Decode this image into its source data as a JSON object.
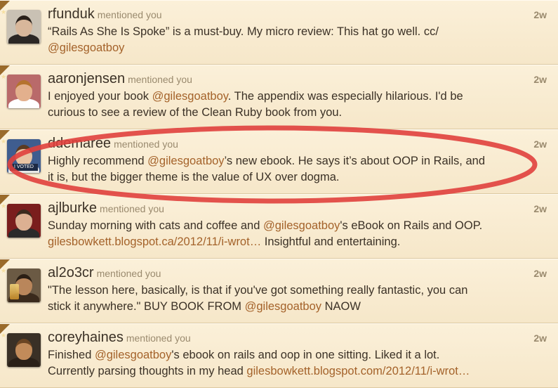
{
  "mention_label": "mentioned you",
  "colors": {
    "link": "#a4622a",
    "highlight_ellipse": "#e0403d",
    "background": "#f5e8cc"
  },
  "tweets": [
    {
      "username": "rfunduk",
      "time": "2w",
      "avatar": "avatar-dark-hair-man",
      "line1": [
        {
          "t": "“Rails As She Is Spoke” is a must-buy. My micro review: This hat go well. cc/",
          "link": false
        }
      ],
      "line2": [
        {
          "t": "@gilesgoatboy",
          "link": true
        }
      ]
    },
    {
      "username": "aaronjensen",
      "time": "2w",
      "avatar": "avatar-flag-man",
      "line1": [
        {
          "t": "I enjoyed your book ",
          "link": false
        },
        {
          "t": "@gilesgoatboy",
          "link": true
        },
        {
          "t": ". The appendix was especially hilarious. I'd be",
          "link": false
        }
      ],
      "line2": [
        {
          "t": "curious to see a review of the Clean Ruby book from you.",
          "link": false
        }
      ]
    },
    {
      "username": "ddemaree",
      "time": "2w",
      "avatar": "avatar-i-voted",
      "avatar_tag": "I VOTED",
      "line1": [
        {
          "t": "Highly recommend ",
          "link": false
        },
        {
          "t": "@gilesgoatboy",
          "link": true
        },
        {
          "t": "’s new ebook. He says it’s about OOP in Rails, and",
          "link": false
        }
      ],
      "line2": [
        {
          "t": "it is, but the bigger theme is the value of UX over dogma.",
          "link": false
        }
      ]
    },
    {
      "username": "ajlburke",
      "time": "2w",
      "avatar": "avatar-young-man",
      "line1": [
        {
          "t": "Sunday morning with cats and coffee and ",
          "link": false
        },
        {
          "t": "@gilesgoatboy",
          "link": true
        },
        {
          "t": "'s eBook on Rails and OOP.",
          "link": false
        }
      ],
      "line2": [
        {
          "t": "gilesbowkett.blogspot.ca/2012/11/i-wrot…",
          "link": true
        },
        {
          "t": " Insightful and entertaining.",
          "link": false
        }
      ]
    },
    {
      "username": "al2o3cr",
      "time": "2w",
      "avatar": "avatar-beer-man",
      "line1": [
        {
          "t": "\"The lesson here, basically, is that if you've got something really fantastic, you can",
          "link": false
        }
      ],
      "line2": [
        {
          "t": "stick it anywhere.\" BUY BOOK FROM ",
          "link": false
        },
        {
          "t": "@gilesgoatboy",
          "link": true
        },
        {
          "t": " NAOW",
          "link": false
        }
      ]
    },
    {
      "username": "coreyhaines",
      "time": "2w",
      "avatar": "avatar-bearded-man",
      "line1": [
        {
          "t": "Finished ",
          "link": false
        },
        {
          "t": "@gilesgoatboy",
          "link": true
        },
        {
          "t": "'s ebook on rails and oop in one sitting. Liked it a lot.",
          "link": false
        }
      ],
      "line2": [
        {
          "t": "Currently parsing thoughts in my head ",
          "link": false
        },
        {
          "t": "gilesbowkett.blogspot.com/2012/11/i-wrot…",
          "link": true
        }
      ]
    }
  ]
}
